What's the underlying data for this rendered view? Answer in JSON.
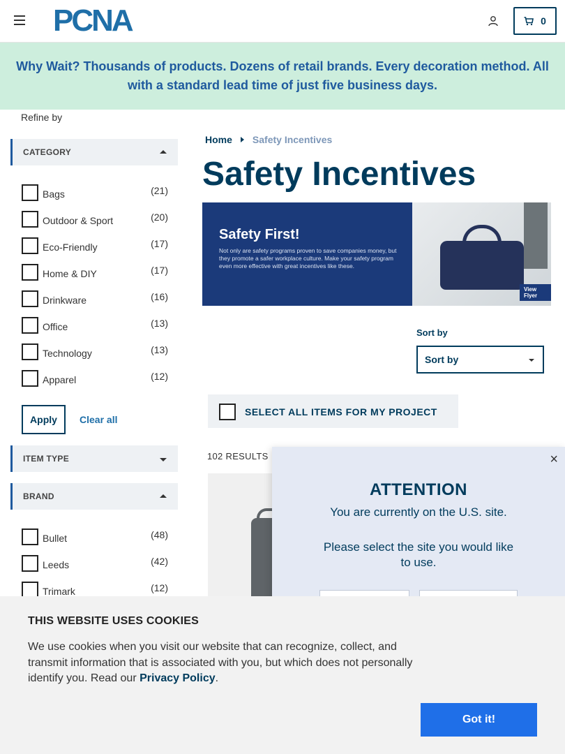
{
  "header": {
    "logo_text": "PCNA",
    "cart_count": "0"
  },
  "promo": {
    "text": "Why Wait? Thousands of products. Dozens of retail brands. Every decoration method. All with a standard lead time of just five business days."
  },
  "sidebar": {
    "refine_label": "Refine by",
    "category": {
      "heading": "CATEGORY",
      "items": [
        {
          "label": "Bags",
          "count": "(21)"
        },
        {
          "label": "Outdoor & Sport",
          "count": "(20)"
        },
        {
          "label": "Eco-Friendly",
          "count": "(17)"
        },
        {
          "label": "Home & DIY",
          "count": "(17)"
        },
        {
          "label": "Drinkware",
          "count": "(16)"
        },
        {
          "label": "Office",
          "count": "(13)"
        },
        {
          "label": "Technology",
          "count": "(13)"
        },
        {
          "label": "Apparel",
          "count": "(12)"
        }
      ]
    },
    "apply_label": "Apply",
    "clear_label": "Clear all",
    "item_type": {
      "heading": "ITEM TYPE"
    },
    "brand": {
      "heading": "BRAND",
      "items": [
        {
          "label": "Bullet",
          "count": "(48)"
        },
        {
          "label": "Leeds",
          "count": "(42)"
        },
        {
          "label": "Trimark",
          "count": "(12)"
        }
      ]
    }
  },
  "main": {
    "breadcrumb_home": "Home",
    "breadcrumb_current": "Safety Incentives",
    "page_title": "Safety Incentives",
    "hero": {
      "title": "Safety First!",
      "body": "Not only are safety programs proven to save companies money, but they promote a safer workplace culture. Make your safety program even more effective with great incentives like these.",
      "flyer_label": "View Flyer"
    },
    "sort_label": "Sort by",
    "sort_value": "Sort by",
    "select_all_label": "SELECT ALL ITEMS FOR MY PROJECT",
    "results_label": "102 RESULTS"
  },
  "modal": {
    "close": "×",
    "title": "ATTENTION",
    "line1": "You are currently on the U.S. site.",
    "line2": "Please select the site you would like to use."
  },
  "cookie": {
    "title": "THIS WEBSITE USES COOKIES",
    "text": "We use cookies when you visit our website that can recognize, collect, and transmit information that is associated with you, but which does not personally identify you. Read our ",
    "link": "Privacy Policy",
    "suffix": ".",
    "button": "Got it!"
  }
}
